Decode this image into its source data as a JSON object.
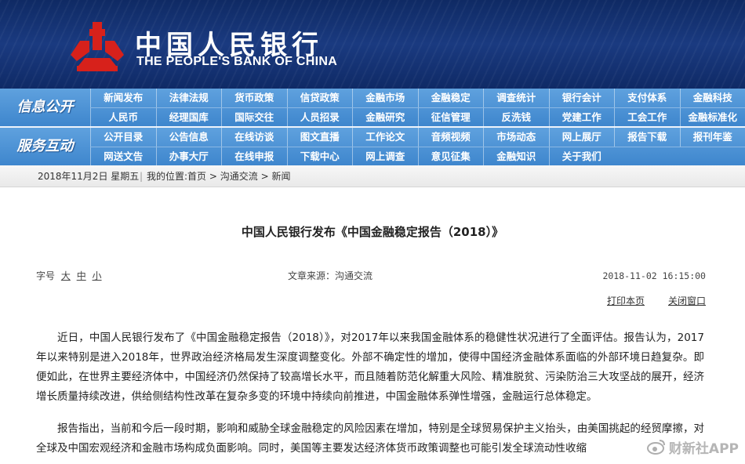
{
  "header": {
    "title_cn": "中国人民银行",
    "title_en": "THE PEOPLE'S BANK OF CHINA",
    "logo_icon": "pboc-logo-icon",
    "colors": {
      "banner": "#1a3a80",
      "logo_red": "#d7211b",
      "nav": "#4a90d4"
    }
  },
  "nav": {
    "info": {
      "label": "信息公开",
      "row1": [
        "新闻发布",
        "法律法规",
        "货币政策",
        "信贷政策",
        "金融市场",
        "金融稳定",
        "调查统计",
        "银行会计",
        "支付体系",
        "金融科技"
      ],
      "row2": [
        "人民币",
        "经理国库",
        "国际交往",
        "人员招录",
        "金融研究",
        "征信管理",
        "反洗钱",
        "党建工作",
        "工会工作",
        "金融标准化"
      ]
    },
    "service": {
      "label": "服务互动",
      "row1": [
        "公开目录",
        "公告信息",
        "在线访谈",
        "图文直播",
        "工作论文",
        "音频视频",
        "市场动态",
        "网上展厅",
        "报告下载",
        "报刊年鉴"
      ],
      "row2": [
        "网送文告",
        "办事大厅",
        "在线申报",
        "下载中心",
        "网上调查",
        "意见征集",
        "金融知识",
        "关于我们"
      ]
    }
  },
  "breadcrumb": {
    "date": "2018年11月2日  星期五",
    "sep": "|",
    "prefix": "我的位置:",
    "items": [
      "首页",
      "沟通交流",
      "新闻"
    ],
    "arrow": " > "
  },
  "article": {
    "title": "中国人民银行发布《中国金融稳定报告（2018）》",
    "font_size_label": "字号",
    "font_sizes": [
      "大",
      "中",
      "小"
    ],
    "source": "文章来源：沟通交流",
    "time": "2018-11-02  16:15:00",
    "print_label": "打印本页",
    "close_label": "关闭窗口",
    "paragraphs": [
      "近日，中国人民银行发布了《中国金融稳定报告（2018）》，对2017年以来我国金融体系的稳健性状况进行了全面评估。报告认为，2017年以来特别是进入2018年，世界政治经济格局发生深度调整变化。外部不确定性的增加，使得中国经济金融体系面临的外部环境日趋复杂。即便如此，在世界主要经济体中，中国经济仍然保持了较高增长水平，而且随着防范化解重大风险、精准脱贫、污染防治三大攻坚战的展开，经济增长质量持续改进，供给侧结构性改革在复杂多变的环境中持续向前推进，中国金融体系弹性增强，金融运行总体稳定。",
      "报告指出，当前和今后一段时期，影响和威胁全球金融稳定的风险因素在增加，特别是全球贸易保护主义抬头，由美国挑起的经贸摩擦，对全球及中国宏观经济和金融市场构成负面影响。同时，美国等主要发达经济体货币政策调整也可能引发全球流动性收缩"
    ]
  },
  "watermark": {
    "text": "财新社APP",
    "icon": "weibo-icon"
  }
}
